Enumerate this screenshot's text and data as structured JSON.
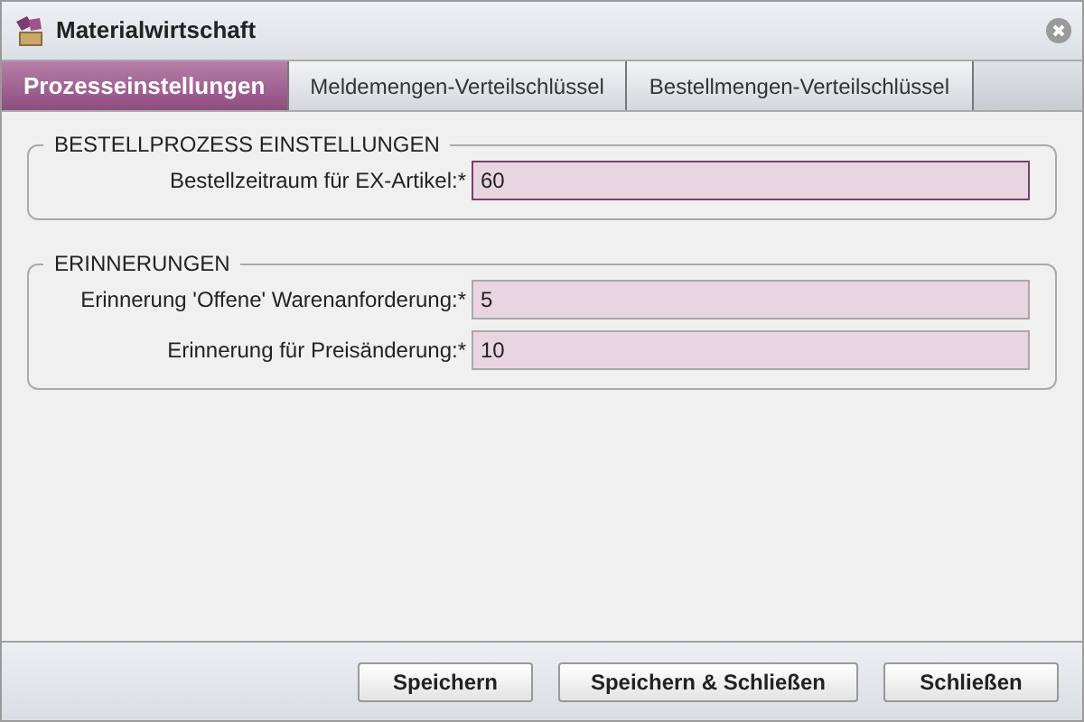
{
  "window": {
    "title": "Materialwirtschaft"
  },
  "tabs": [
    {
      "label": "Prozesseinstellungen",
      "selected": true
    },
    {
      "label": "Meldemengen-Verteilschlüssel",
      "selected": false
    },
    {
      "label": "Bestellmengen-Verteilschlüssel",
      "selected": false
    }
  ],
  "sections": [
    {
      "title": "BESTELLPROZESS EINSTELLUNGEN",
      "fields": [
        {
          "label": "Bestellzeitraum für EX-Artikel:*",
          "value": "60",
          "focused": true
        }
      ]
    },
    {
      "title": "ERINNERUNGEN",
      "fields": [
        {
          "label": "Erinnerung 'Offene' Warenanforderung:*",
          "value": "5",
          "focused": false
        },
        {
          "label": "Erinnerung für Preisänderung:*",
          "value": "10",
          "focused": false
        }
      ]
    }
  ],
  "buttons": [
    "Speichern",
    "Speichern & Schließen",
    "Schließen"
  ]
}
